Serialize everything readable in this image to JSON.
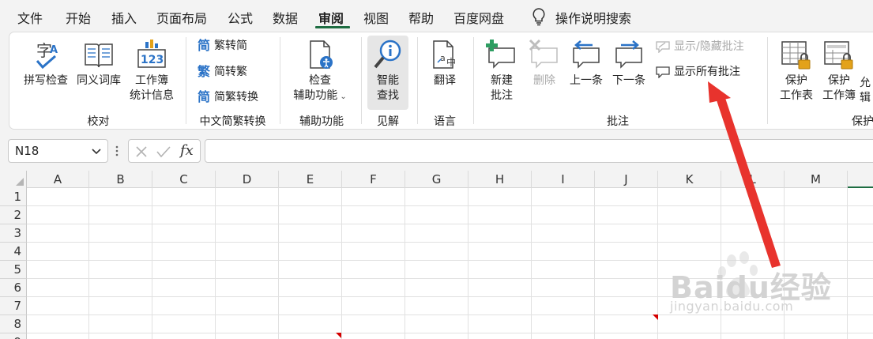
{
  "tabs": [
    {
      "label": "文件",
      "active": false
    },
    {
      "label": "开始",
      "active": false
    },
    {
      "label": "插入",
      "active": false
    },
    {
      "label": "页面布局",
      "active": false
    },
    {
      "label": "公式",
      "active": false
    },
    {
      "label": "数据",
      "active": false
    },
    {
      "label": "审阅",
      "active": true
    },
    {
      "label": "视图",
      "active": false
    },
    {
      "label": "帮助",
      "active": false
    },
    {
      "label": "百度网盘",
      "active": false
    }
  ],
  "tell_me": "操作说明搜索",
  "ribbon": {
    "proofing": {
      "label": "校对",
      "spell": "拼写检查",
      "thesaurus": "同义词库",
      "stats_l1": "工作簿",
      "stats_l2": "统计信息",
      "stats_icon_text": "123"
    },
    "chinese": {
      "label": "中文简繁转换",
      "to_simplified": "繁转简",
      "to_traditional": "简转繁",
      "convert": "简繁转换",
      "icon_simplified": "简",
      "icon_traditional": "繁",
      "icon_convert": "简"
    },
    "accessibility": {
      "label": "辅助功能",
      "l1": "检查",
      "l2": "辅助功能"
    },
    "insights": {
      "label": "见解",
      "l1": "智能",
      "l2": "查找"
    },
    "language": {
      "label": "语言",
      "translate": "翻译"
    },
    "comments": {
      "label": "批注",
      "new_l1": "新建",
      "new_l2": "批注",
      "delete": "删除",
      "prev": "上一条",
      "next": "下一条",
      "show_hide": "显示/隐藏批注",
      "show_all": "显示所有批注"
    },
    "protect": {
      "label": "保护",
      "sheet_l1": "保护",
      "sheet_l2": "工作表",
      "book_l1": "保护",
      "book_l2": "工作簿",
      "allow_l1": "允",
      "allow_l2": "辑"
    }
  },
  "formula_bar": {
    "name_box": "N18",
    "fx": "fx",
    "value": ""
  },
  "grid": {
    "columns": [
      "A",
      "B",
      "C",
      "D",
      "E",
      "F",
      "G",
      "H",
      "I",
      "J",
      "K",
      "L",
      "M"
    ],
    "rows": [
      "1",
      "2",
      "3",
      "4",
      "5",
      "6",
      "7",
      "8",
      "9"
    ]
  },
  "watermark": {
    "brand": "Baidu经验",
    "url": "jingyan.baidu.com"
  },
  "colors": {
    "accent": "#1e6d42",
    "annotation": "#e8332d",
    "comment_marker": "#d40000"
  }
}
